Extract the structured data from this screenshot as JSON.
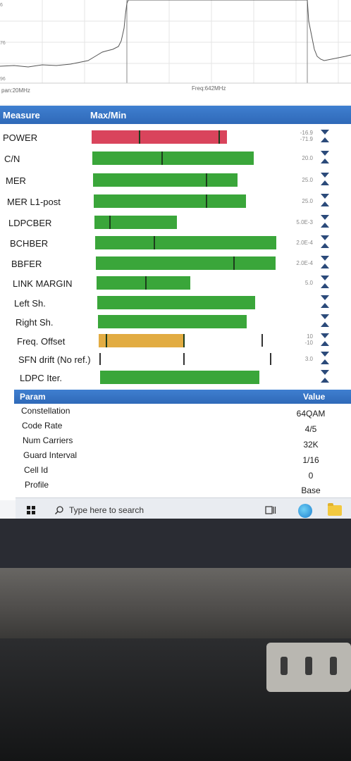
{
  "spectrum": {
    "span_label": "pan:20MHz",
    "freq_label": "Freq:642MHz",
    "scale_top": "6",
    "scale_mid": "76",
    "scale_low": "96"
  },
  "measure_header": {
    "col1": "Measure",
    "col2": "Max/Min"
  },
  "measures": [
    {
      "label": "POWER",
      "value": "-16.9\n-71.9",
      "fill": 0.74
    },
    {
      "label": "C/N",
      "value": "20.0",
      "fill": 0.88
    },
    {
      "label": "MER",
      "value": "25.0",
      "fill": 0.79
    },
    {
      "label": "MER L1-post",
      "value": "25.0",
      "fill": 0.83
    },
    {
      "label": "LDPCBER",
      "value": "5.0E-3",
      "fill": 0.45
    },
    {
      "label": "BCHBER",
      "value": "2.0E-4",
      "fill": 0.99
    },
    {
      "label": "BBFER",
      "value": "2.0E-4",
      "fill": 0.98
    },
    {
      "label": "LINK MARGIN",
      "value": "5.0",
      "fill": 0.51
    },
    {
      "label": "Left Sh.",
      "value": "",
      "fill": 0.86
    },
    {
      "label": "Right Sh.",
      "value": "",
      "fill": 0.81
    },
    {
      "label": "Freq. Offset",
      "value": "10\n-10",
      "fill": 0.46
    },
    {
      "label": "SFN drift (No ref.)",
      "value": "3.0",
      "fill": 0.0
    },
    {
      "label": "LDPC Iter.",
      "value": "",
      "fill": 0.87
    }
  ],
  "param_header": {
    "col1": "Param",
    "col2": "Value"
  },
  "params": [
    {
      "label": "Constellation",
      "value": "64QAM"
    },
    {
      "label": "Code Rate",
      "value": "4/5"
    },
    {
      "label": "Num Carriers",
      "value": "32K"
    },
    {
      "label": "Guard Interval",
      "value": "1/16"
    },
    {
      "label": "Cell Id",
      "value": "0"
    },
    {
      "label": "Profile",
      "value": "Base"
    }
  ],
  "taskbar": {
    "search_placeholder": "Type here to search"
  },
  "colors": {
    "header_blue": "#2f69b8",
    "bar_green": "#3aa63a",
    "bar_red": "#d9445c",
    "bar_orange": "#e2ac42"
  },
  "icons": [
    "windows-start-icon",
    "search-icon",
    "task-view-icon",
    "edge-browser-icon",
    "file-explorer-icon"
  ]
}
